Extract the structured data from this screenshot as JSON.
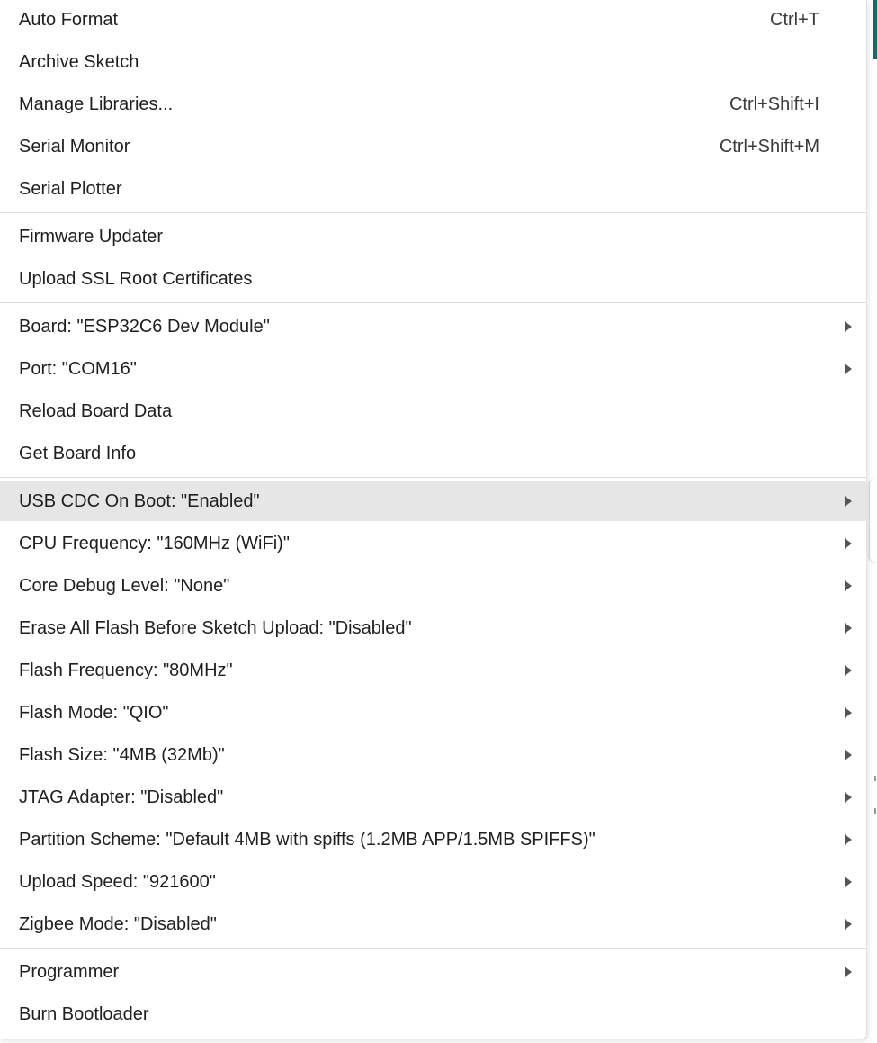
{
  "menu": {
    "items": [
      {
        "label": "Auto Format",
        "shortcut": "Ctrl+T"
      },
      {
        "label": "Archive Sketch",
        "shortcut": ""
      },
      {
        "label": "Manage Libraries...",
        "shortcut": "Ctrl+Shift+I"
      },
      {
        "label": "Serial Monitor",
        "shortcut": "Ctrl+Shift+M"
      },
      {
        "label": "Serial Plotter",
        "shortcut": ""
      },
      {
        "label": "Firmware Updater",
        "shortcut": ""
      },
      {
        "label": "Upload SSL Root Certificates",
        "shortcut": ""
      },
      {
        "label": "Board: \"ESP32C6 Dev Module\"",
        "shortcut": ""
      },
      {
        "label": "Port: \"COM16\"",
        "shortcut": ""
      },
      {
        "label": "Reload Board Data",
        "shortcut": ""
      },
      {
        "label": "Get Board Info",
        "shortcut": ""
      },
      {
        "label": "USB CDC On Boot: \"Enabled\"",
        "shortcut": ""
      },
      {
        "label": "CPU Frequency: \"160MHz (WiFi)\"",
        "shortcut": ""
      },
      {
        "label": "Core Debug Level: \"None\"",
        "shortcut": ""
      },
      {
        "label": "Erase All Flash Before Sketch Upload: \"Disabled\"",
        "shortcut": ""
      },
      {
        "label": "Flash Frequency: \"80MHz\"",
        "shortcut": ""
      },
      {
        "label": "Flash Mode: \"QIO\"",
        "shortcut": ""
      },
      {
        "label": "Flash Size: \"4MB (32Mb)\"",
        "shortcut": ""
      },
      {
        "label": "JTAG Adapter: \"Disabled\"",
        "shortcut": ""
      },
      {
        "label": "Partition Scheme: \"Default 4MB with spiffs (1.2MB APP/1.5MB SPIFFS)\"",
        "shortcut": ""
      },
      {
        "label": "Upload Speed: \"921600\"",
        "shortcut": ""
      },
      {
        "label": "Zigbee Mode: \"Disabled\"",
        "shortcut": ""
      },
      {
        "label": "Programmer",
        "shortcut": ""
      },
      {
        "label": "Burn Bootloader",
        "shortcut": ""
      }
    ],
    "submenu_icon": "chevron-right-icon",
    "highlight_color": "#e6e6e6"
  }
}
